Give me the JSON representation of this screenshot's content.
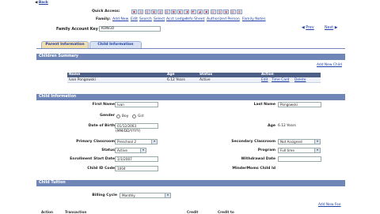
{
  "top": {
    "back_link": "Back"
  },
  "quick_access": {
    "label": "Quick Access:",
    "icons": [
      "icon-1",
      "icon-2",
      "icon-3",
      "icon-4",
      "icon-5",
      "icon-6",
      "icon-7",
      "icon-8",
      "icon-9",
      "icon-10",
      "icon-11",
      "icon-12",
      "icon-13",
      "icon-14",
      "icon-15",
      "icon-16",
      "icon-17"
    ]
  },
  "family_links": {
    "label": "Family:",
    "links": [
      "Add New",
      "Edit",
      "Search",
      "Select",
      "Acct Ledger",
      "Info Sheet",
      "Authorized Person",
      "Family Notes"
    ]
  },
  "family_account": {
    "label": "Family Account Key",
    "value": "KONGO",
    "prev": "Prev",
    "next": "Next"
  },
  "tabs": [
    {
      "label": "Parent Information"
    },
    {
      "label": "Child Information"
    }
  ],
  "children_summary": {
    "title": "Children Summary",
    "add_link": "Add New Child",
    "columns": [
      "Name",
      "Age",
      "Status",
      "Action"
    ],
    "rows": [
      {
        "name": "Ivan Pongowski",
        "age": "6.12 Years",
        "status": "Active",
        "actions": [
          "Edit",
          "Time Card",
          "Delete"
        ]
      }
    ]
  },
  "child_info": {
    "title": "Child Information",
    "first_name_label": "First Name",
    "first_name": "Ivan",
    "last_name_label": "Last Name",
    "last_name": "Pongowski",
    "gender_label": "Gender",
    "gender_boy": "Boy",
    "gender_girl": "Girl",
    "dob_label": "Date of Birth",
    "dob": "01/12/2003",
    "dob_hint": "(MM/DD/YYYY)",
    "age_label": "Age",
    "age": "6.12 Years",
    "primary_label": "Primary Classroom",
    "primary": "Preschool 2",
    "secondary_label": "Secondary Classroom",
    "secondary": "Not Assigned",
    "status_label": "Status",
    "status": "Active",
    "program_label": "Program",
    "program": "Full time",
    "enroll_label": "Enrollment Start Date",
    "enroll": "1/1/2007",
    "withdrawal_label": "Withdrawal Date",
    "withdrawal": "",
    "idcode_label": "Child ID Code",
    "idcode": "1004",
    "minder_label": "MinderMoms Child Id"
  },
  "child_tuition": {
    "title": "Child Tuition",
    "billing_label": "Billing Cycle",
    "billing": "Monthly",
    "add_link": "Add New Fee",
    "columns": [
      "Action",
      "Transaction",
      "",
      "Credit",
      "Credit to"
    ]
  }
}
